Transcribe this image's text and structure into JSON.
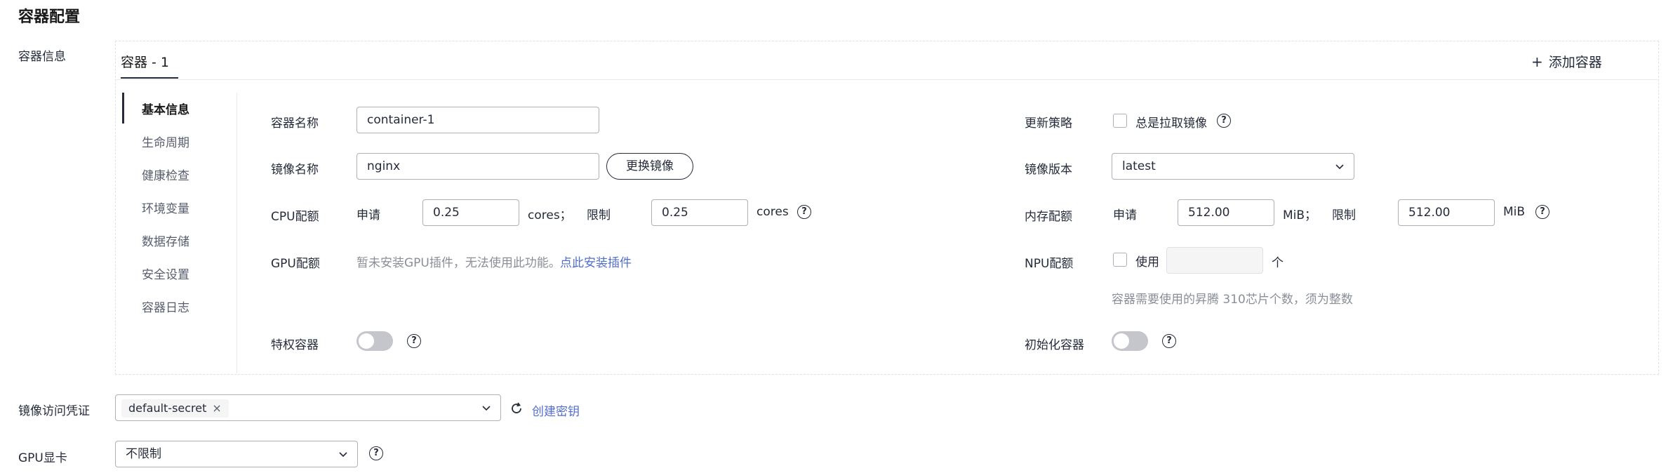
{
  "section_title": "容器配置",
  "container_info_label": "容器信息",
  "tabs": [
    {
      "label": "容器 - 1"
    }
  ],
  "add_container_label": "添加容器",
  "side_nav": [
    {
      "label": "基本信息"
    },
    {
      "label": "生命周期"
    },
    {
      "label": "健康检查"
    },
    {
      "label": "环境变量"
    },
    {
      "label": "数据存储"
    },
    {
      "label": "安全设置"
    },
    {
      "label": "容器日志"
    }
  ],
  "form": {
    "container_name": {
      "label": "容器名称",
      "value": "container-1"
    },
    "image_name": {
      "label": "镜像名称",
      "value": "nginx",
      "replace_button": "更换镜像"
    },
    "cpu_quota": {
      "label": "CPU配额",
      "request_label": "申请",
      "request_value": "0.25",
      "request_unit": "cores；",
      "limit_label": "限制",
      "limit_value": "0.25",
      "limit_unit": "cores"
    },
    "gpu_quota": {
      "label": "GPU配额",
      "message": "暂未安装GPU插件，无法使用此功能。",
      "install_link": "点此安装插件"
    },
    "privileged": {
      "label": "特权容器"
    },
    "update_policy": {
      "label": "更新策略",
      "checkbox_label": "总是拉取镜像"
    },
    "image_version": {
      "label": "镜像版本",
      "value": "latest"
    },
    "memory_quota": {
      "label": "内存配额",
      "request_label": "申请",
      "request_value": "512.00",
      "request_unit": "MiB；",
      "limit_label": "限制",
      "limit_value": "512.00",
      "limit_unit": "MiB"
    },
    "npu_quota": {
      "label": "NPU配额",
      "checkbox_label": "使用",
      "unit": "个",
      "hint": "容器需要使用的昇腾 310芯片个数，须为整数"
    },
    "init_container": {
      "label": "初始化容器"
    }
  },
  "image_credential": {
    "label": "镜像访问凭证",
    "tag": "default-secret",
    "create_link": "创建密钥"
  },
  "gpu_card": {
    "label": "GPU显卡",
    "value": "不限制"
  },
  "help_glyph": "?",
  "close_glyph": "×",
  "plus_glyph": "+"
}
